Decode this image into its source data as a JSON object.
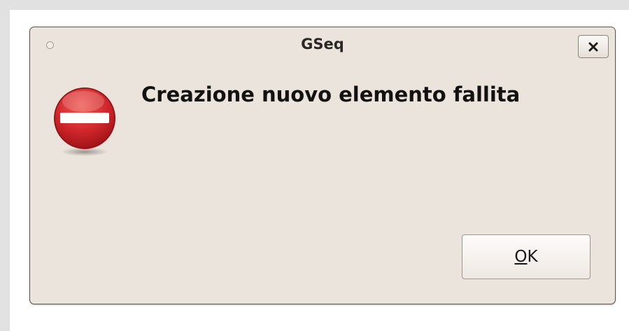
{
  "dialog": {
    "title": "GSeq",
    "message": "Creazione nuovo elemento fallita",
    "ok_label": "OK",
    "icons": {
      "window_menu": "circle-dot-icon",
      "close": "close-icon",
      "status": "error-no-entry-icon"
    },
    "colors": {
      "background": "#ebe4dd",
      "error_red": "#c8242a"
    }
  }
}
